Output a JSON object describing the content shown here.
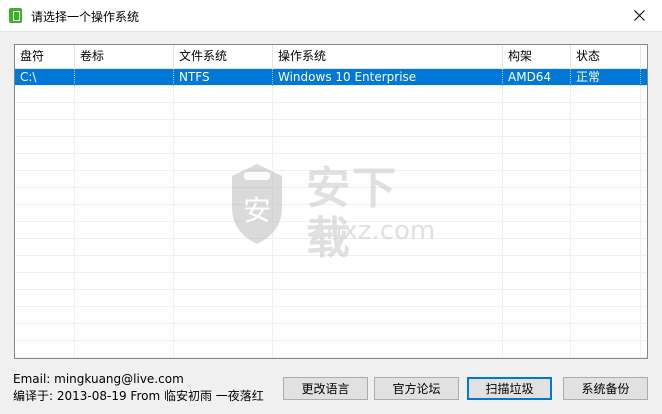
{
  "window": {
    "title": "请选择一个操作系统"
  },
  "table": {
    "columns": [
      "盘符",
      "卷标",
      "文件系统",
      "操作系统",
      "构架",
      "状态"
    ],
    "rows": [
      {
        "drive": "C:\\",
        "label": "",
        "fs": "NTFS",
        "os": "Windows 10 Enterprise",
        "arch": "AMD64",
        "status": "正常",
        "selected": true
      }
    ]
  },
  "watermark": {
    "main": "安下载",
    "sub": "anxz.com",
    "shield_glyph": "安"
  },
  "footer": {
    "email_line": "Email: mingkuang@live.com",
    "compiled_line": "编译于: 2013-08-19 From 临安初雨 一夜落红"
  },
  "buttons": {
    "language": "更改语言",
    "forum": "官方论坛",
    "scan": "扫描垃圾",
    "backup": "系统备份"
  },
  "colors": {
    "selection": "#0078d7",
    "app_icon": "#3fae29"
  }
}
